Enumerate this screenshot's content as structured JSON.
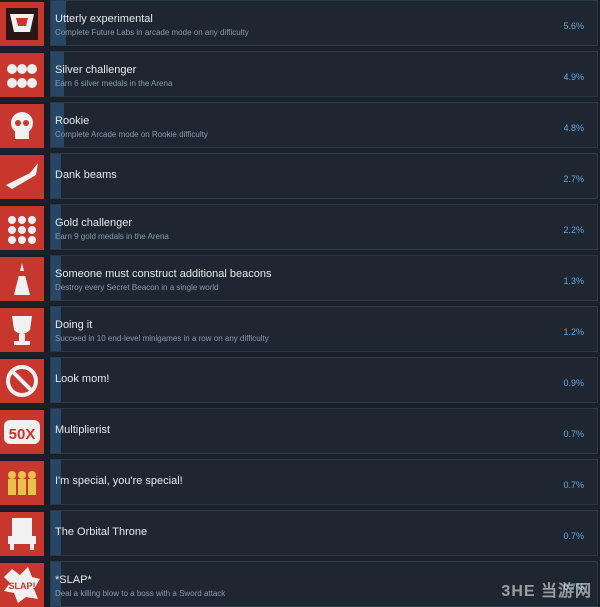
{
  "achievements": [
    {
      "title": "Utterly experimental",
      "description": "Complete Future Labs in arcade mode on any difficulty",
      "percent": "5.6%",
      "fill": 0.056,
      "icon": "helmet-icon"
    },
    {
      "title": "Silver challenger",
      "description": "Earn 6 silver medals in the Arena",
      "percent": "4.9%",
      "fill": 0.049,
      "icon": "silver-medals-icon"
    },
    {
      "title": "Rookie",
      "description": "Complete Arcade mode on Rookie difficulty",
      "percent": "4.8%",
      "fill": 0.048,
      "icon": "skull-icon"
    },
    {
      "title": "Dank beams",
      "description": "",
      "percent": "2.7%",
      "fill": 0.027,
      "icon": "beam-weapon-icon"
    },
    {
      "title": "Gold challenger",
      "description": "Earn 9 gold medals in the Arena",
      "percent": "2.2%",
      "fill": 0.022,
      "icon": "gold-medals-icon"
    },
    {
      "title": "Someone must construct additional beacons",
      "description": "Destroy every Secret Beacon in a single world",
      "percent": "1.3%",
      "fill": 0.013,
      "icon": "beacon-icon"
    },
    {
      "title": "Doing it",
      "description": "Succeed in 10 end-level minigames in a row on any difficulty",
      "percent": "1.2%",
      "fill": 0.012,
      "icon": "trophy-icon"
    },
    {
      "title": "Look mom!",
      "description": "",
      "percent": "0.9%",
      "fill": 0.009,
      "icon": "crossed-circle-icon"
    },
    {
      "title": "Multiplierist",
      "description": "",
      "percent": "0.7%",
      "fill": 0.007,
      "icon": "multiplier-50x-icon"
    },
    {
      "title": "I'm special, you're special!",
      "description": "",
      "percent": "0.7%",
      "fill": 0.007,
      "icon": "three-figures-icon"
    },
    {
      "title": "The Orbital Throne",
      "description": "",
      "percent": "0.7%",
      "fill": 0.007,
      "icon": "throne-icon"
    },
    {
      "title": "*SLAP*",
      "description": "Deal a killing blow to a boss with a Sword attack",
      "percent": "0.7%",
      "fill": 0.007,
      "icon": "slap-icon",
      "icon_text": "SLAP!"
    }
  ],
  "watermark": "3HE 当游网",
  "colors": {
    "bar": "#284766",
    "percent": "#6aa6dd",
    "icon_bg": "#c8372d"
  }
}
